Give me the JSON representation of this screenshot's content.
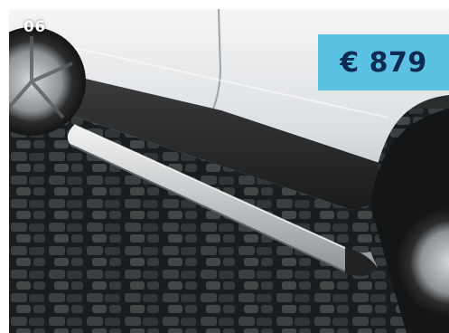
{
  "tile": {
    "index_label": "06",
    "price_label": "€ 879"
  },
  "colors": {
    "price_background": "#5bc2e4",
    "price_text": "#0e2a52",
    "index_text": "#ffffff"
  },
  "image": {
    "subject": "running-board-photo"
  }
}
